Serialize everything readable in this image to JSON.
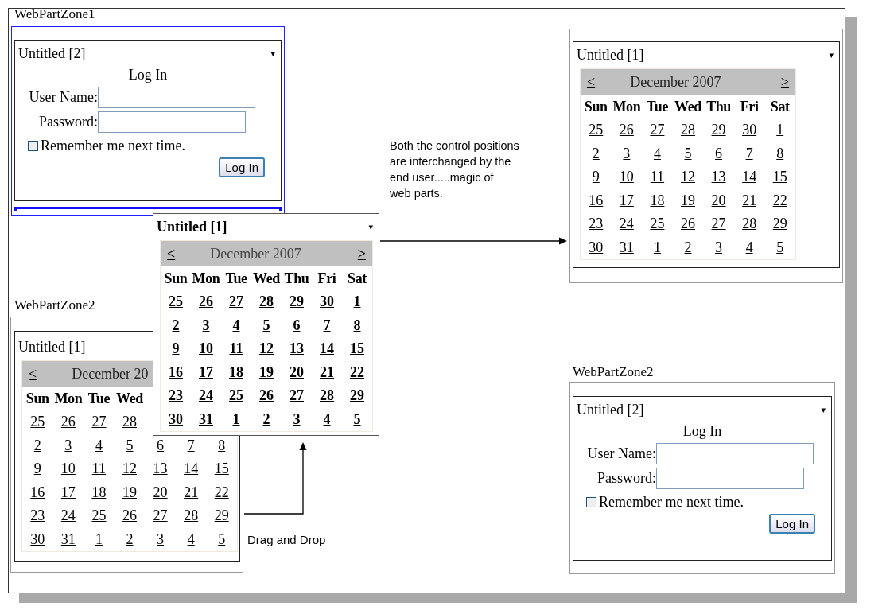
{
  "zones": [
    {
      "label": "WebPartZone1",
      "highlighted": true,
      "drop_indicator": true,
      "part": {
        "kind": "login",
        "title": "Untitled [2]",
        "menu": "▾",
        "heading": "Log In",
        "fields": [
          {
            "label": "User Name:"
          },
          {
            "label": "Password:"
          }
        ],
        "remember": {
          "label": "Remember me next time.",
          "checked": false
        },
        "button": "Log In"
      }
    },
    {
      "label": "WebPartZone2",
      "highlighted": false,
      "drop_indicator": false,
      "part": {
        "kind": "calendar",
        "title": "Untitled [1]",
        "prev": "<",
        "month": "December 20",
        "weekdays": [
          "Sun",
          "Mon",
          "Tue",
          "Wed"
        ],
        "weeks": [
          [
            "25",
            "26",
            "27",
            "28"
          ],
          [
            "2",
            "3",
            "4",
            "5",
            "6",
            "7",
            "8"
          ],
          [
            "9",
            "10",
            "11",
            "12",
            "13",
            "14",
            "15"
          ],
          [
            "16",
            "17",
            "18",
            "19",
            "20",
            "21",
            "22"
          ],
          [
            "23",
            "24",
            "25",
            "26",
            "27",
            "28",
            "29"
          ],
          [
            "30",
            "31",
            "1",
            "2",
            "3",
            "4",
            "5"
          ]
        ]
      }
    },
    {
      "highlighted": false,
      "drop_indicator": false,
      "part": {
        "kind": "calendar",
        "title": "Untitled [1]",
        "menu": "▾",
        "prev": "<",
        "month": "December 2007",
        "next": ">",
        "weekdays": [
          "Sun",
          "Mon",
          "Tue",
          "Wed",
          "Thu",
          "Fri",
          "Sat"
        ],
        "weeks": [
          [
            "25",
            "26",
            "27",
            "28",
            "29",
            "30",
            "1"
          ],
          [
            "2",
            "3",
            "4",
            "5",
            "6",
            "7",
            "8"
          ],
          [
            "9",
            "10",
            "11",
            "12",
            "13",
            "14",
            "15"
          ],
          [
            "16",
            "17",
            "18",
            "19",
            "20",
            "21",
            "22"
          ],
          [
            "23",
            "24",
            "25",
            "26",
            "27",
            "28",
            "29"
          ],
          [
            "30",
            "31",
            "1",
            "2",
            "3",
            "4",
            "5"
          ]
        ]
      }
    },
    {
      "label": "WebPartZone2",
      "highlighted": false,
      "drop_indicator": false,
      "part": {
        "kind": "login",
        "title": "Untitled [2]",
        "menu": "▾",
        "heading": "Log In",
        "fields": [
          {
            "label": "User Name:"
          },
          {
            "label": "Password:"
          }
        ],
        "remember": {
          "label": "Remember me next time.",
          "checked": false
        },
        "button": "Log In"
      }
    }
  ],
  "dragged_part": {
    "kind": "calendar",
    "dragging": true,
    "title": "Untitled [1]",
    "menu": "▾",
    "prev": "<",
    "month": "December 2007",
    "next": ">",
    "weekdays": [
      "Sun",
      "Mon",
      "Tue",
      "Wed",
      "Thu",
      "Fri",
      "Sat"
    ],
    "weeks": [
      [
        "25",
        "26",
        "27",
        "28",
        "29",
        "30",
        "1"
      ],
      [
        "2",
        "3",
        "4",
        "5",
        "6",
        "7",
        "8"
      ],
      [
        "9",
        "10",
        "11",
        "12",
        "13",
        "14",
        "15"
      ],
      [
        "16",
        "17",
        "18",
        "19",
        "20",
        "21",
        "22"
      ],
      [
        "23",
        "24",
        "25",
        "26",
        "27",
        "28",
        "29"
      ],
      [
        "30",
        "31",
        "1",
        "2",
        "3",
        "4",
        "5"
      ]
    ]
  },
  "note_lines": [
    "Both the control positions",
    "are interchanged by the",
    "end user.....magic of",
    "web parts."
  ],
  "drag_label": "Drag and Drop"
}
